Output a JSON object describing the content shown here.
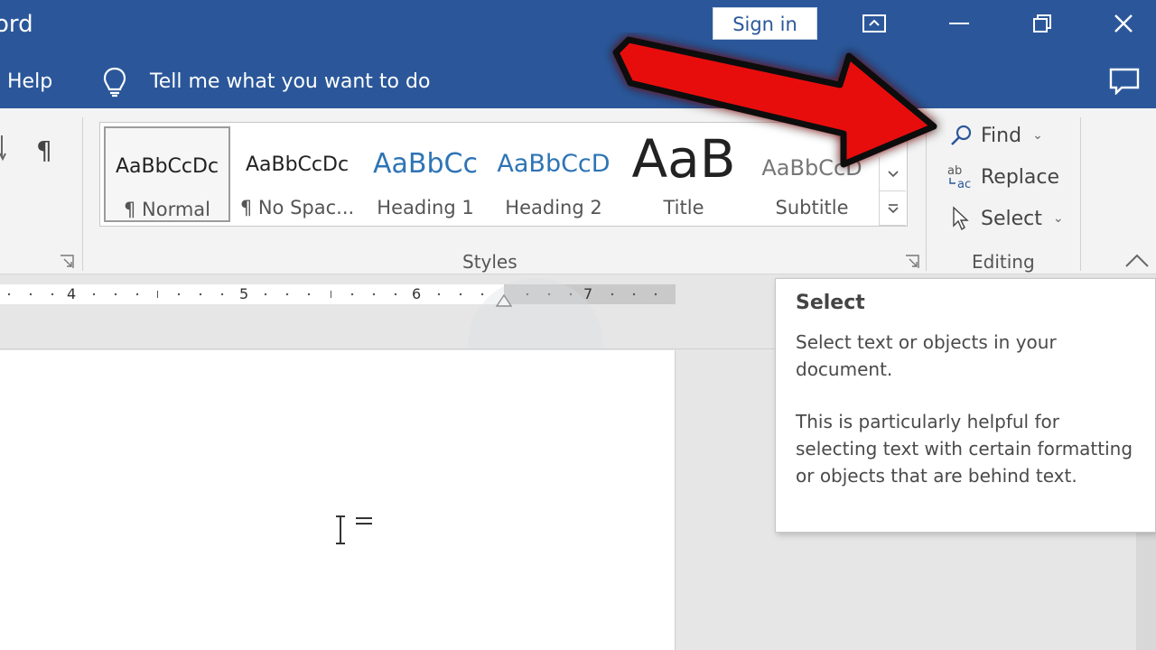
{
  "titlebar": {
    "app_title": "ord",
    "signin_label": "Sign in"
  },
  "menubar": {
    "help_label": "Help",
    "tellme_label": "Tell me what you want to do"
  },
  "styles": {
    "group_label": "Styles",
    "items": [
      {
        "sample": "AaBbCcDc",
        "name": "¶ Normal"
      },
      {
        "sample": "AaBbCcDc",
        "name": "¶ No Spac..."
      },
      {
        "sample": "AaBbCc",
        "name": "Heading 1"
      },
      {
        "sample": "AaBbCcD",
        "name": "Heading 2"
      },
      {
        "sample": "AaB",
        "name": "Title"
      },
      {
        "sample": "AaBbCcD",
        "name": "Subtitle"
      }
    ]
  },
  "editing": {
    "group_label": "Editing",
    "find_label": "Find",
    "replace_label": "Replace",
    "select_label": "Select"
  },
  "ruler": {
    "numbers": [
      "4",
      "5",
      "6",
      "7"
    ]
  },
  "tooltip": {
    "title": "Select",
    "line1": "Select text or objects in your document.",
    "line2": "This is particularly helpful for selecting text with certain formatting or objects that are behind text."
  },
  "colors": {
    "word_blue": "#2b579a",
    "heading_blue": "#2e74b5",
    "arrow_red": "#e8100c"
  }
}
